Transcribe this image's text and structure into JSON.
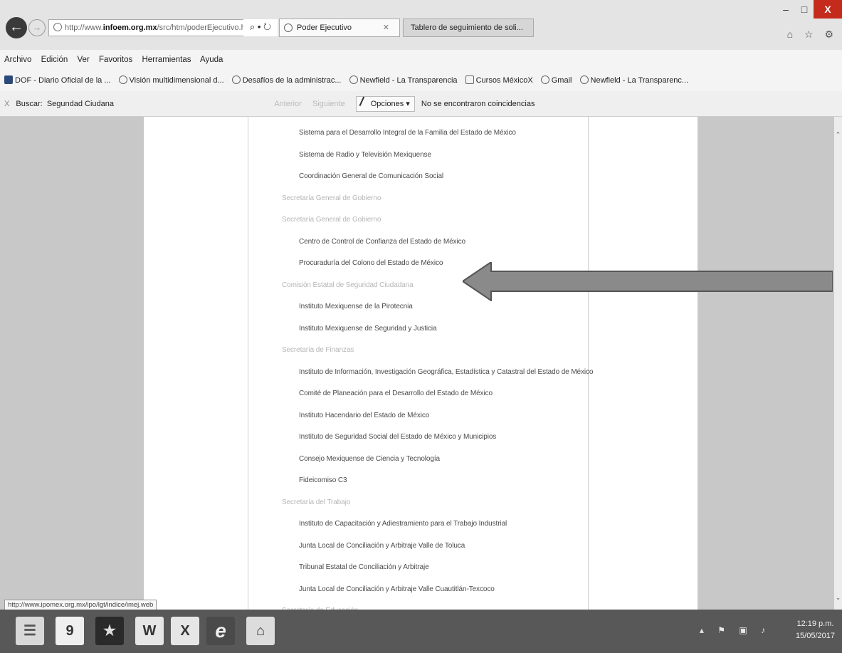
{
  "browser": {
    "address_host": "infoem.org.mx",
    "address_prefix": "http://www.",
    "address_rest": "/src/htm/poderEjecutivo.h",
    "address_controls": "⌕ • ↻",
    "tabs": [
      {
        "label": "Poder Ejecutivo",
        "active": true
      },
      {
        "label": "Tablero de seguimiento de soli...",
        "active": false
      }
    ],
    "window_controls": {
      "minimize": "–",
      "maximize": "□",
      "close": "X"
    },
    "side_icons": "⌂ ☆ ⚙"
  },
  "menubar": [
    "Archivo",
    "Edición",
    "Ver",
    "Favoritos",
    "Herramientas",
    "Ayuda"
  ],
  "favorites": [
    {
      "label": "DOF - Diario Oficial de la ...",
      "icon": "dof-icon"
    },
    {
      "label": "Visión multidimensional d...",
      "icon": "google-icon"
    },
    {
      "label": "Desafíos de la administrac...",
      "icon": "sun-icon"
    },
    {
      "label": "Newfield - La Transparencia",
      "icon": "newfield-icon"
    },
    {
      "label": "Cursos MéxicoX",
      "icon": "page-icon"
    },
    {
      "label": "Gmail",
      "icon": "google-icon"
    },
    {
      "label": "Newfield - La Transparenc...",
      "icon": "newfield-icon"
    }
  ],
  "findbar": {
    "close": "X",
    "label": "Buscar:",
    "value": "Segundad Ciudana",
    "prev": "Anterior",
    "next": "Siguiente",
    "options": "Opciones",
    "result": "No se encontraron coincidencias"
  },
  "list": [
    {
      "text": "Sistema para el Desarrollo Integral de la Familia del Estado de México",
      "level": "child"
    },
    {
      "text": "Sistema de Radio y Televisión Mexiquense",
      "level": "child"
    },
    {
      "text": "Coordinación General de Comunicación Social",
      "level": "child"
    },
    {
      "text": "Secretaría General de Gobierno",
      "level": "parent"
    },
    {
      "text": "Secretaría General de Gobierno",
      "level": "parent"
    },
    {
      "text": "Centro de Control de Confianza del Estado de México",
      "level": "child"
    },
    {
      "text": "Procuraduría del Colono del Estado de México",
      "level": "child"
    },
    {
      "text": "Comisión Estatal de Seguridad Ciudadana",
      "level": "parent"
    },
    {
      "text": "Instituto Mexiquense de la Pirotecnia",
      "level": "child"
    },
    {
      "text": "Instituto Mexiquense de Seguridad y Justicia",
      "level": "child"
    },
    {
      "text": "Secretaría de Finanzas",
      "level": "parent"
    },
    {
      "text": "Instituto de Información, Investigación Geográfica, Estadística y Catastral del Estado de México",
      "level": "child"
    },
    {
      "text": "Comité de Planeación para el Desarrollo del Estado de México",
      "level": "child"
    },
    {
      "text": "Instituto Hacendario del Estado de México",
      "level": "child"
    },
    {
      "text": "Instituto de Seguridad Social del Estado de México y Municipios",
      "level": "child"
    },
    {
      "text": "Consejo Mexiquense de Ciencia y Tecnología",
      "level": "child"
    },
    {
      "text": "Fideicomiso C3",
      "level": "child"
    },
    {
      "text": "Secretaría del Trabajo",
      "level": "parent"
    },
    {
      "text": "Instituto de Capacitación y Adiestramiento para el Trabajo Industrial",
      "level": "child"
    },
    {
      "text": "Junta Local de Conciliación y Arbitraje Valle de Toluca",
      "level": "child"
    },
    {
      "text": "Tribunal Estatal de Conciliación y Arbitraje",
      "level": "child"
    },
    {
      "text": "Junta Local de Conciliación y Arbitraje Valle Cuautitlán-Texcoco",
      "level": "child"
    },
    {
      "text": "Secretaría de Educación",
      "level": "parent"
    }
  ],
  "status_url": "http://www.ipomex.org.mx/ipo/lgt/indice/imej.web",
  "taskbar": {
    "apps": [
      {
        "label": "☰",
        "icon": "file-explorer-icon"
      },
      {
        "label": "9",
        "icon": "app-9-icon"
      },
      {
        "label": "★",
        "icon": "app-game-icon"
      },
      {
        "label": "W",
        "icon": "word-icon"
      },
      {
        "label": "X",
        "icon": "excel-icon"
      },
      {
        "label": "e",
        "icon": "internet-explorer-icon"
      },
      {
        "label": "⌂",
        "icon": "pdf-icon"
      }
    ],
    "tray": "▴ ⚑ ▣ ♪",
    "time": "12:19 p.m.",
    "date": "15/05/2017"
  },
  "colors": {
    "accent_close": "#c42b1c",
    "arrow_fill": "#8a8a8a",
    "side_panel": "#c8c8c8",
    "taskbar": "#585858"
  }
}
